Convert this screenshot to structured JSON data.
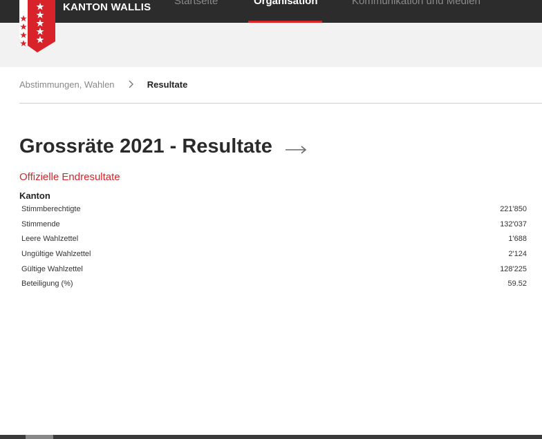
{
  "header": {
    "brand": "KANTON WALLIS",
    "nav": [
      {
        "label": "Startseite",
        "active": false
      },
      {
        "label": "Organisation",
        "active": true
      },
      {
        "label": "Kommunikation und Medien",
        "active": false
      }
    ]
  },
  "breadcrumb": {
    "parent": "Abstimmungen, Wahlen",
    "separator": ">",
    "current": "Resultate"
  },
  "page": {
    "title": "Grossräte 2021 - Resultate",
    "subtitle": "Offizielle Endresultate",
    "section_title": "Kanton"
  },
  "results": [
    {
      "label": "Stimmberechtigte",
      "value": "221'850"
    },
    {
      "label": "Stimmende",
      "value": "132'037"
    },
    {
      "label": "Leere Wahlzettel",
      "value": "1'688"
    },
    {
      "label": "Ungültige Wahlzettel",
      "value": "2'124"
    },
    {
      "label": "Gültige Wahlzettel",
      "value": "128'225"
    },
    {
      "label": "Beteiligung (%)",
      "value": "59.52"
    }
  ],
  "colors": {
    "accent": "#d8232a",
    "topbar": "#2c2c2c",
    "band": "#f2f2f2"
  },
  "icons": [
    "canton-valais-coat-of-arms-icon",
    "chevron-right-icon",
    "arrow-right-icon"
  ]
}
